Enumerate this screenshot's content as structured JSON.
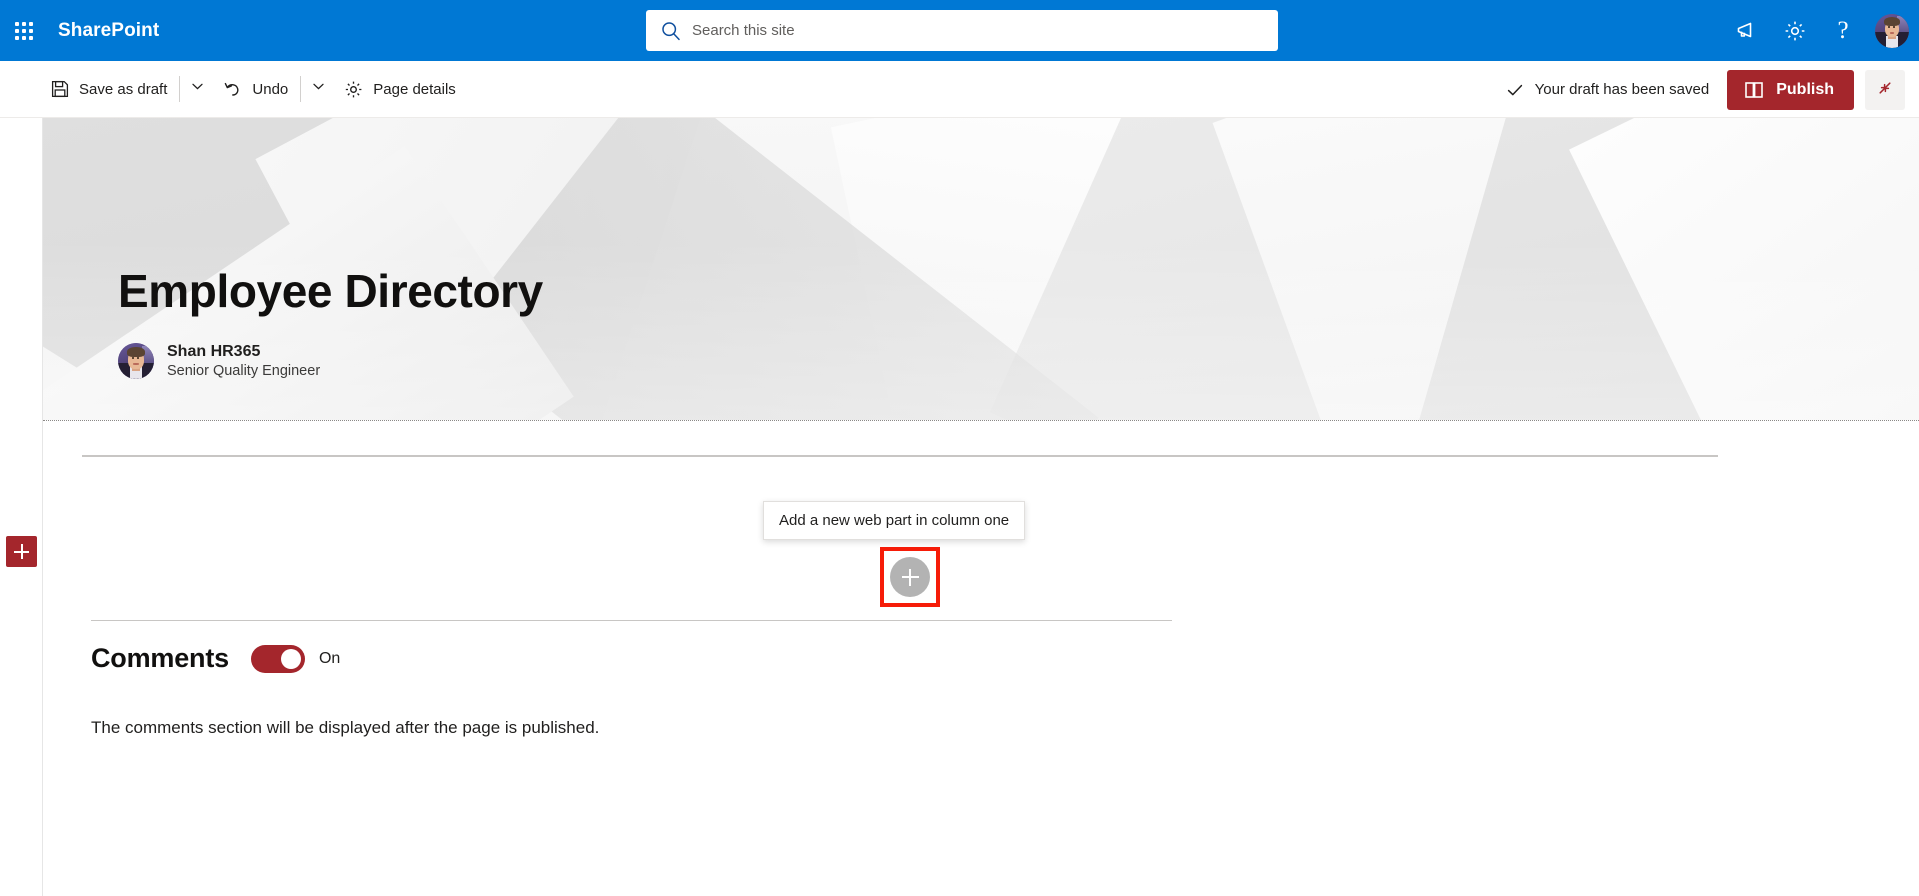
{
  "suite": {
    "waffle_label": "App launcher",
    "brand": "SharePoint",
    "search": {
      "placeholder": "Search this site",
      "value": "",
      "icon": "search-icon"
    },
    "actions": [
      {
        "name": "announcements-icon",
        "label": "Announcements"
      },
      {
        "name": "gear-icon",
        "label": "Settings"
      },
      {
        "name": "help-icon",
        "label": "Help",
        "glyph": "?"
      }
    ],
    "avatar_label": "Account manager"
  },
  "command_bar": {
    "save_as_draft": "Save as draft",
    "save_as_draft_chevron": "chevron-down-icon",
    "undo": "Undo",
    "undo_chevron": "chevron-down-icon",
    "page_details": "Page details",
    "draft_status": "Your draft has been saved",
    "draft_status_icon": "checkmark-icon",
    "publish": "Publish",
    "publish_icon": "publish-book-icon",
    "collapse_label": "Collapse",
    "collapse_icon": "collapse-arrows-icon"
  },
  "hero": {
    "title": "Employee Directory",
    "author_name": "Shan HR365",
    "author_role": "Senior Quality Engineer",
    "author_avatar_label": "Shan HR365 profile picture"
  },
  "canvas": {
    "add_section_label": "Add a new section",
    "add_webpart_label": "Add a new web part in column one",
    "tooltip": "Add a new web part in column one",
    "highlight_color": "#f61c08"
  },
  "comments": {
    "title": "Comments",
    "toggle_state": "On",
    "toggle_label": "On",
    "note": "The comments section will be displayed after the page is published."
  },
  "colors": {
    "suite_blue": "#0078d4",
    "accent_red": "#a4262c",
    "highlight_red": "#f61c08",
    "text_primary": "#201f1e"
  }
}
